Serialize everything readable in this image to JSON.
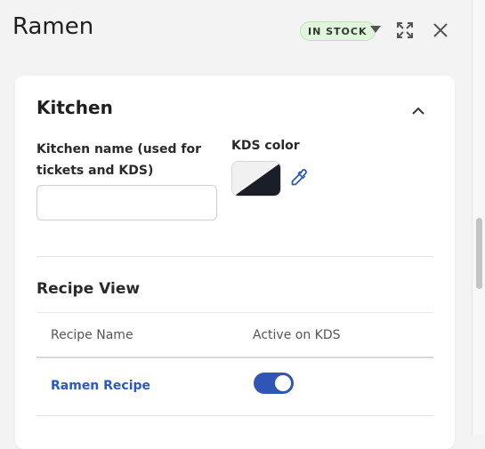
{
  "header": {
    "title": "Ramen",
    "status_badge": "IN STOCK"
  },
  "colors": {
    "accent": "#2f55b5",
    "link": "#2b5bb8",
    "badge_bg": "#e3f4de",
    "kds_color": "#1b1d27"
  },
  "kitchen": {
    "section_title": "Kitchen",
    "name_label": "Kitchen name (used for tickets and KDS)",
    "name_label_line1": "Kitchen name (used for",
    "name_label_line2": "tickets and KDS)",
    "name_value": "",
    "color_label": "KDS color"
  },
  "recipe_view": {
    "title": "Recipe View",
    "columns": [
      "Recipe Name",
      "Active on KDS"
    ],
    "rows": [
      {
        "name": "Ramen Recipe",
        "active": true
      }
    ]
  },
  "icons": {
    "status_menu": "caret-down-icon",
    "expand": "expand-icon",
    "close": "close-icon",
    "collapse": "chevron-up-icon",
    "eyedropper": "eyedropper-icon"
  }
}
